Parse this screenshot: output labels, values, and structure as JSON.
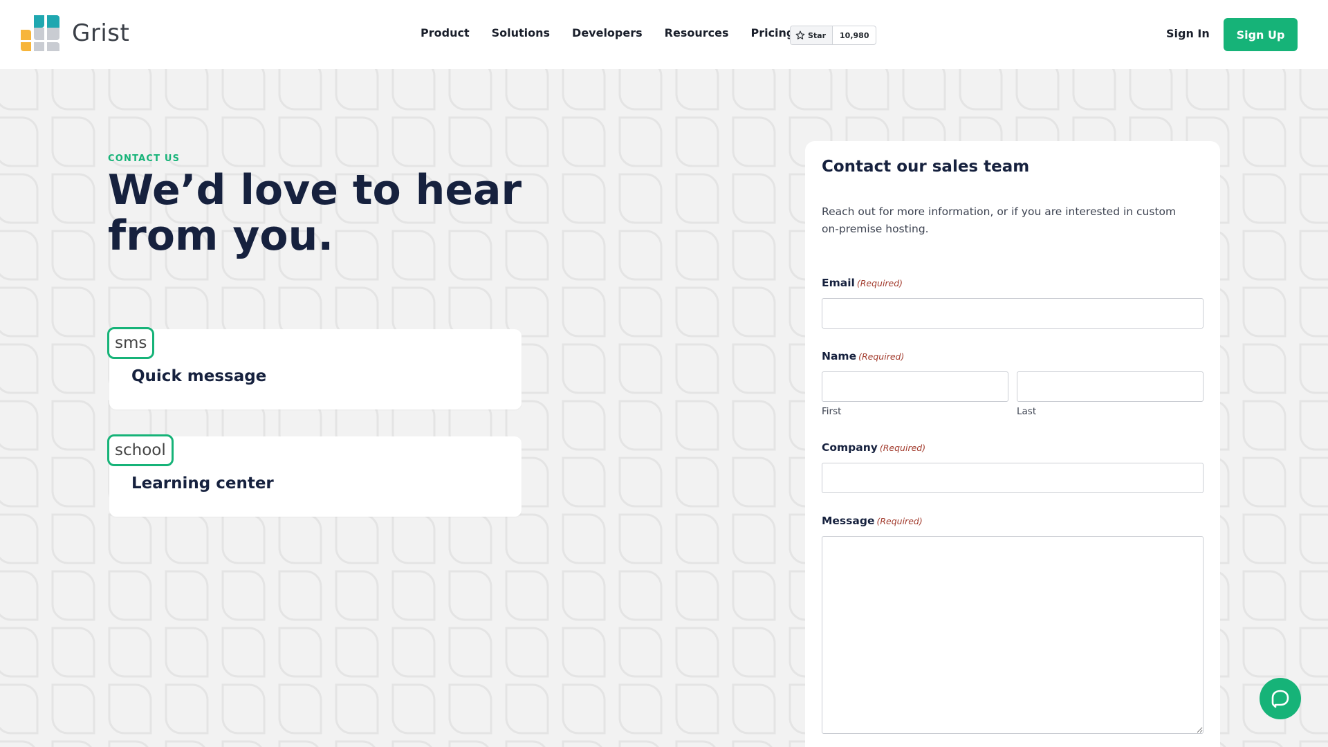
{
  "brand": {
    "name": "Grist"
  },
  "nav": {
    "items": [
      {
        "label": "Product"
      },
      {
        "label": "Solutions"
      },
      {
        "label": "Developers"
      },
      {
        "label": "Resources"
      },
      {
        "label": "Pricing"
      }
    ]
  },
  "github": {
    "star_label": "Star",
    "count": "10,980"
  },
  "auth": {
    "signin": "Sign In",
    "signup": "Sign Up"
  },
  "hero": {
    "eyebrow": "CONTACT US",
    "headline": "We’d love to hear from you."
  },
  "cards": [
    {
      "icon_text": "sms",
      "title": "Quick message"
    },
    {
      "icon_text": "school",
      "title": "Learning center"
    }
  ],
  "form": {
    "title": "Contact our sales team",
    "description": "Reach out for more information, or if you are interested in custom on-premise hosting.",
    "required_tag": "(Required)",
    "email_label": "Email",
    "name_label": "Name",
    "first_label": "First",
    "last_label": "Last",
    "company_label": "Company",
    "message_label": "Message",
    "email_value": "",
    "first_value": "",
    "last_value": "",
    "company_value": "",
    "message_value": ""
  },
  "colors": {
    "accent": "#16b378",
    "heading": "#16213e",
    "background": "#f2f2f2",
    "required": "#a23b2d"
  },
  "icons": {
    "logo": "grist-logo-icon",
    "star": "star-icon",
    "chat": "chat-bubble-icon"
  }
}
